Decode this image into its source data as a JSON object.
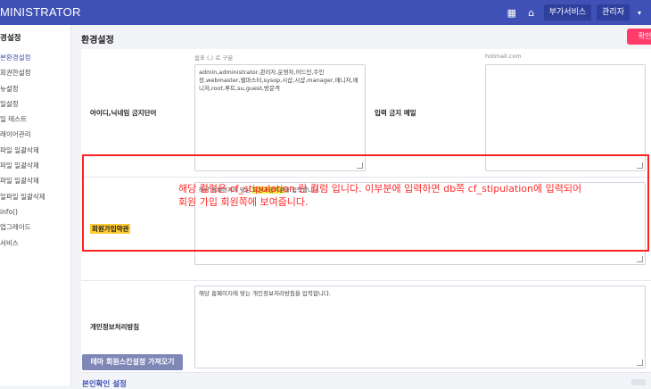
{
  "topbar": {
    "brand": "MINISTRATOR",
    "home_icon": "home-icon",
    "grid_icon": "grid-icon",
    "btn_addon": "부가서비스",
    "btn_admin": "관리자",
    "caret": "▾"
  },
  "sidebar": {
    "title": "경설정",
    "items": [
      {
        "label": "본환경설정",
        "active": true
      },
      {
        "label": "회권한설정"
      },
      {
        "label": "뉴설정"
      },
      {
        "label": "일설정"
      },
      {
        "label": "일 테스트"
      },
      {
        "label": "레이어관리"
      },
      {
        "label": "파일 일괄삭제"
      },
      {
        "label": "파일 일괄삭제"
      },
      {
        "label": "파일 일괄삭제"
      },
      {
        "label": "일파일 일괄삭제"
      },
      {
        "label": "info()"
      },
      {
        "label": "업그레이드"
      },
      {
        "label": "서비스"
      }
    ]
  },
  "main": {
    "title": "환경설정",
    "confirm": "확인",
    "rows": {
      "banned_words": {
        "label": "아이디,닉네임 금지단어",
        "hint": "쉼표 (,) 로 구분",
        "value": "admin,administrator,관리자,운영자,어드민,주인장,webmaster,웹마스터,sysop,시삽,시샵,manager,매니저,메니저,root,루트,su,guest,방문객",
        "label2": "입력 금지 메일",
        "placeholder": "hotmail.com"
      },
      "stipulation": {
        "label": "회원가입약관",
        "text_before": "해당 홈페이지에 맞는 ",
        "text_highlight": "회원가입약관",
        "text_after": "을 입력합니다."
      },
      "privacy": {
        "label": "개인정보처리방침",
        "text": "해당 홈페이지에 맞는 개인정보처리방침을 입력합니다."
      }
    },
    "annotation": "해당 컬럼은 cf_stipulation 란 컬럼 입니다. 이부분에 입력하면 db쪽 cf_stipulation에 입력되어 회원 가입 회원쪽에 보여줍니다.",
    "bottom_button": "테마 회원스킨설정 가져오기",
    "section_title": "본인확인 설정"
  }
}
